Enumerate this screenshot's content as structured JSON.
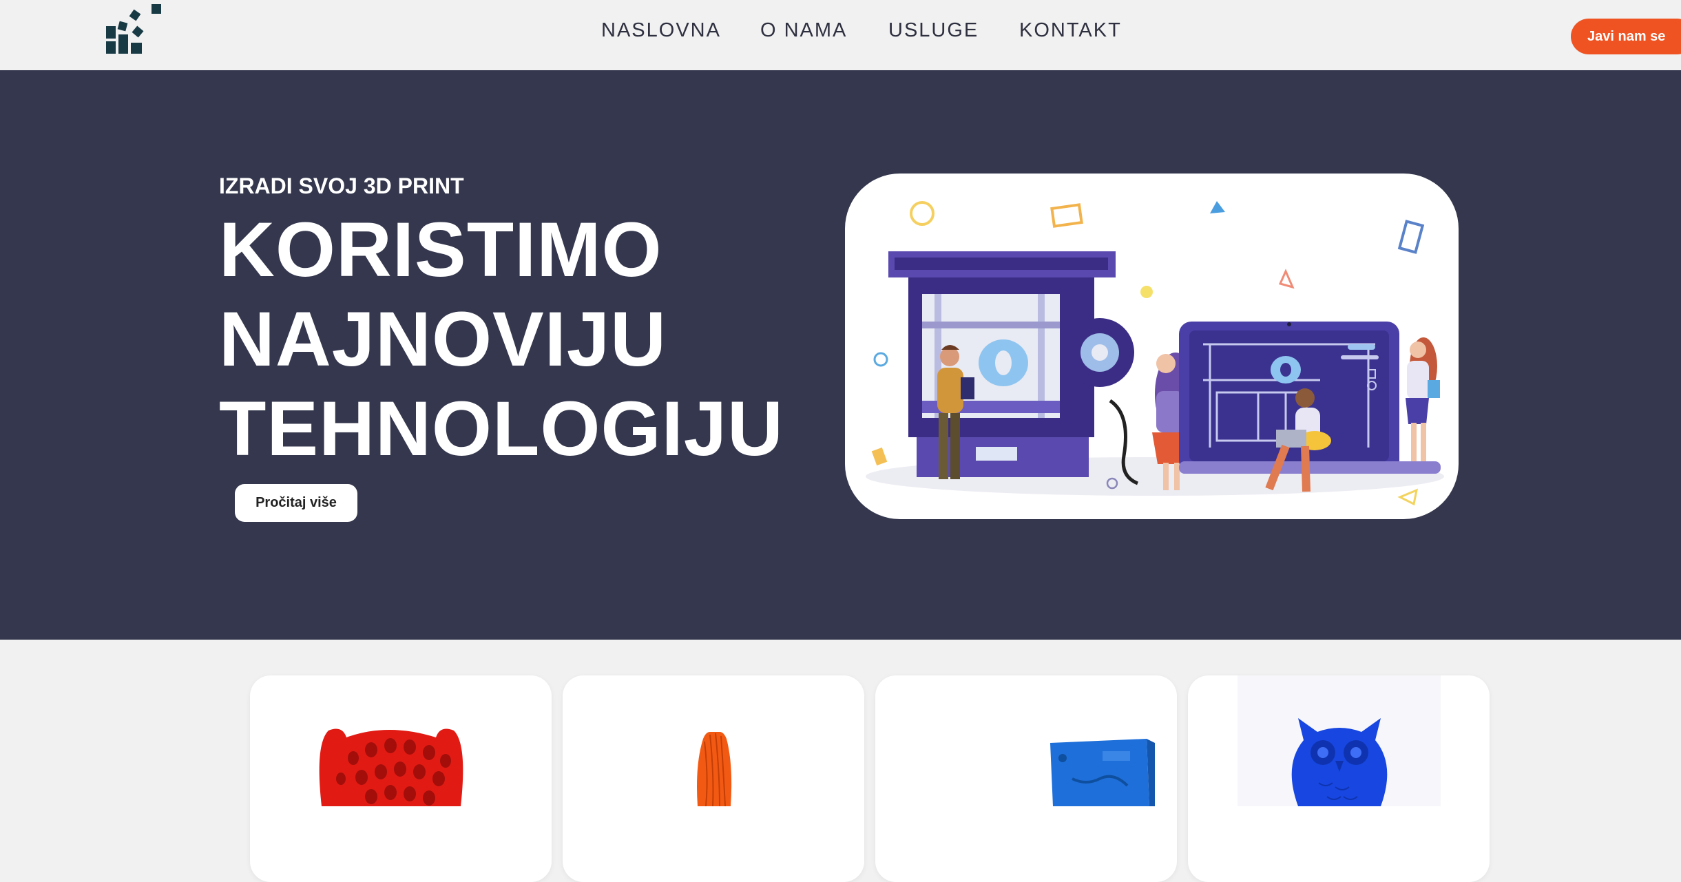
{
  "header": {
    "logo_icon": "blocks-logo-icon",
    "nav": [
      {
        "label": "NASLOVNA"
      },
      {
        "label": "O NAMA"
      },
      {
        "label": "USLUGE"
      },
      {
        "label": "KONTAKT"
      }
    ],
    "cta_label": "Javi nam se"
  },
  "hero": {
    "eyebrow": "IZRADI SVOJ 3D PRINT",
    "headline_lines": [
      "KORISTIMO",
      "NAJNOVIJU",
      "TEHNOLOGIJU"
    ],
    "button_label": "Pročitaj više",
    "illustration_icon": "3d-printing-team-illustration"
  },
  "cards": [
    {
      "image": "red-lattice-print"
    },
    {
      "image": "orange-twisted-vase-print"
    },
    {
      "image": "blue-mold-plate-print"
    },
    {
      "image": "blue-owl-print"
    }
  ],
  "colors": {
    "header_bg": "#f1f1f1",
    "hero_bg": "#34374d",
    "accent": "#ef5322",
    "nav_text": "#2e3040",
    "logo": "#173a45"
  }
}
